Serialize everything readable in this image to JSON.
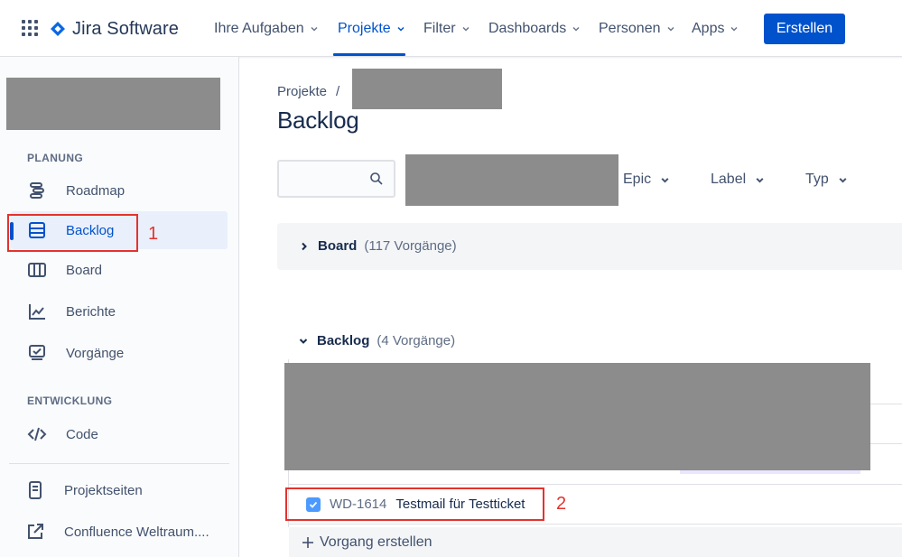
{
  "app": {
    "name": "Jira Software"
  },
  "topnav": {
    "items": [
      {
        "label": "Ihre Aufgaben"
      },
      {
        "label": "Projekte"
      },
      {
        "label": "Filter"
      },
      {
        "label": "Dashboards"
      },
      {
        "label": "Personen"
      },
      {
        "label": "Apps"
      }
    ],
    "active": "Projekte",
    "create_label": "Erstellen"
  },
  "sidebar": {
    "planning_label": "PLANUNG",
    "development_label": "ENTWICKLUNG",
    "items": [
      {
        "label": "Roadmap",
        "icon": "roadmap-icon"
      },
      {
        "label": "Backlog",
        "icon": "backlog-icon",
        "selected": true
      },
      {
        "label": "Board",
        "icon": "board-icon"
      },
      {
        "label": "Berichte",
        "icon": "reports-icon"
      },
      {
        "label": "Vorgänge",
        "icon": "issues-icon"
      },
      {
        "label": "Code",
        "icon": "code-icon"
      },
      {
        "label": "Projektseiten",
        "icon": "page-icon"
      },
      {
        "label": "Confluence Weltraum....",
        "icon": "external-link-icon"
      }
    ]
  },
  "breadcrumb": {
    "root": "Projekte",
    "separator": "/"
  },
  "page": {
    "title": "Backlog"
  },
  "filters": {
    "epic": "Epic",
    "label": "Label",
    "type": "Typ"
  },
  "board_group": {
    "name": "Board",
    "count": "(117 Vorgänge)"
  },
  "backlog_group": {
    "name": "Backlog",
    "count": "(4 Vorgänge)"
  },
  "issue": {
    "key": "WD-1614",
    "summary": "Testmail für Testticket",
    "checked": true
  },
  "create_issue_label": "Vorgang erstellen",
  "annotations": [
    "1",
    "2"
  ],
  "colors": {
    "accent": "#0052cc",
    "annotation": "#e5322d",
    "redaction": "#8c8c8c"
  }
}
